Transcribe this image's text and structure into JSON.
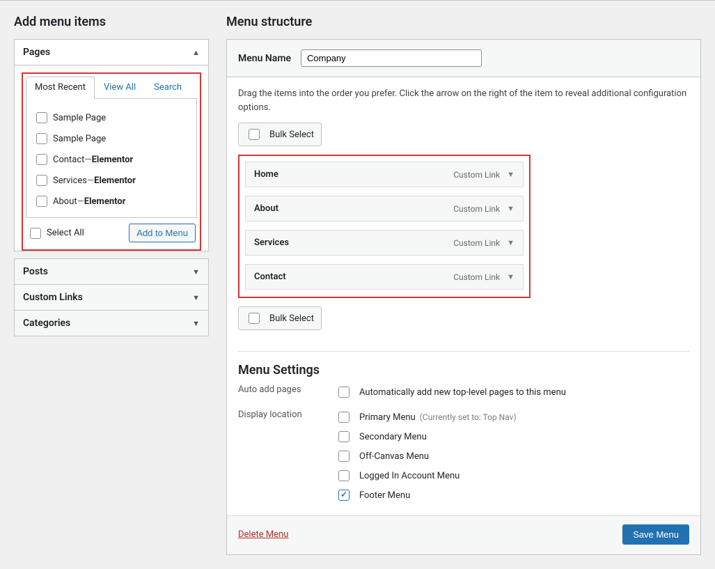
{
  "left": {
    "heading": "Add menu items",
    "pages": {
      "title": "Pages",
      "tabs": {
        "recent": "Most Recent",
        "viewall": "View All",
        "search": "Search"
      },
      "items": [
        {
          "label": "Sample Page",
          "suffix": ""
        },
        {
          "label": "Sample Page",
          "suffix": ""
        },
        {
          "label": "Contact",
          "suffix": "Elementor"
        },
        {
          "label": "Services",
          "suffix": "Elementor"
        },
        {
          "label": "About",
          "suffix": "Elementor"
        }
      ],
      "select_all": "Select All",
      "add_btn": "Add to Menu"
    },
    "posts": "Posts",
    "custom_links": "Custom Links",
    "categories": "Categories"
  },
  "right": {
    "heading": "Menu structure",
    "menu_name_label": "Menu Name",
    "menu_name_value": "Company",
    "hint": "Drag the items into the order you prefer. Click the arrow on the right of the item to reveal additional configuration options.",
    "bulk": "Bulk Select",
    "items": [
      {
        "title": "Home",
        "type": "Custom Link"
      },
      {
        "title": "About",
        "type": "Custom Link"
      },
      {
        "title": "Services",
        "type": "Custom Link"
      },
      {
        "title": "Contact",
        "type": "Custom Link"
      }
    ],
    "settings": {
      "heading": "Menu Settings",
      "auto_label": "Auto add pages",
      "auto_check": "Automatically add new top-level pages to this menu",
      "display_label": "Display location",
      "locations": [
        {
          "label": "Primary Menu",
          "note": "(Currently set to: Top Nav)",
          "checked": false
        },
        {
          "label": "Secondary Menu",
          "note": "",
          "checked": false
        },
        {
          "label": "Off-Canvas Menu",
          "note": "",
          "checked": false
        },
        {
          "label": "Logged In Account Menu",
          "note": "",
          "checked": false
        },
        {
          "label": "Footer Menu",
          "note": "",
          "checked": true
        }
      ]
    },
    "delete": "Delete Menu",
    "save": "Save Menu"
  },
  "dash": " — "
}
